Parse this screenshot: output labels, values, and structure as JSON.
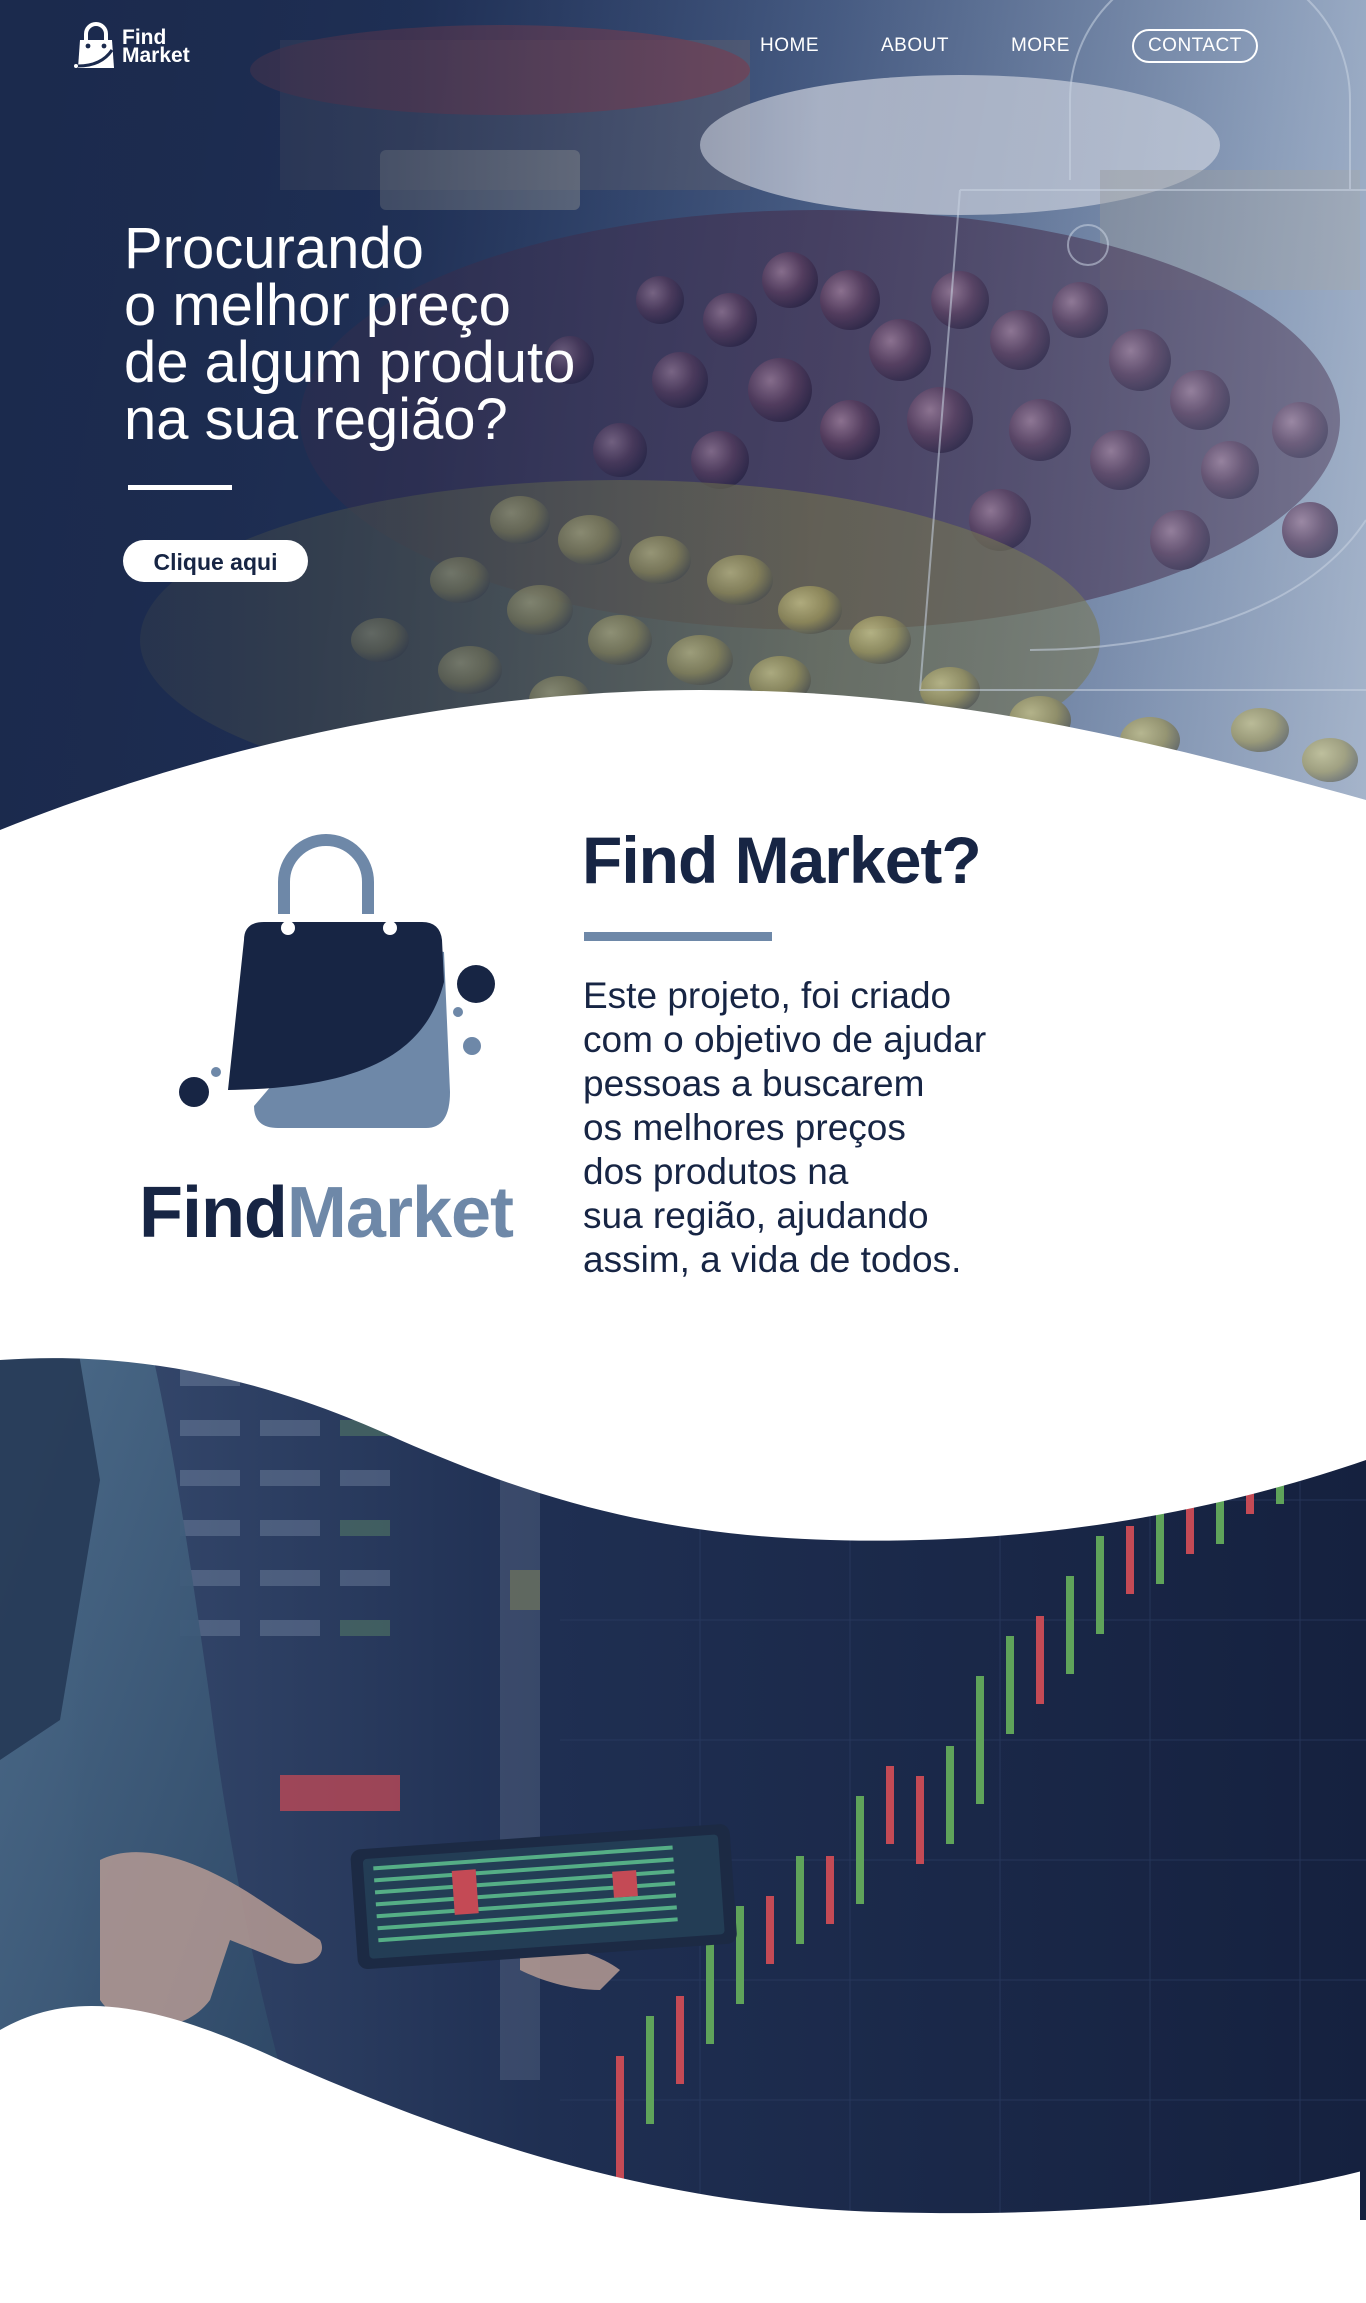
{
  "brand": {
    "logo_line1": "Find",
    "logo_line2": "Market",
    "word_find": "Find",
    "word_market": "Market"
  },
  "nav": {
    "items": [
      {
        "label": "HOME",
        "name": "nav-home"
      },
      {
        "label": "ABOUT",
        "name": "nav-about"
      },
      {
        "label": "MORE",
        "name": "nav-more"
      },
      {
        "label": "CONTACT",
        "name": "nav-contact"
      }
    ]
  },
  "hero": {
    "title_lines": [
      "Procurando",
      "o melhor preço",
      "de algum produto",
      "na sua região?"
    ],
    "cta_label": "Clique aqui"
  },
  "about": {
    "title": "Find Market?",
    "body_lines": [
      "Este projeto, foi criado",
      "com o objetivo de ajudar",
      "pessoas a buscarem",
      "os melhores preços",
      "dos produtos na",
      "sua região, ajudando",
      "assim, a vida de todos."
    ]
  },
  "icons": {
    "logo": "shopping-bag-icon",
    "hero_image": "market-olives-photo",
    "market_image": "stock-chart-tablet-photo"
  },
  "colors": {
    "navy": "#172544",
    "steel_blue": "#6e88a8",
    "white": "#ffffff"
  }
}
